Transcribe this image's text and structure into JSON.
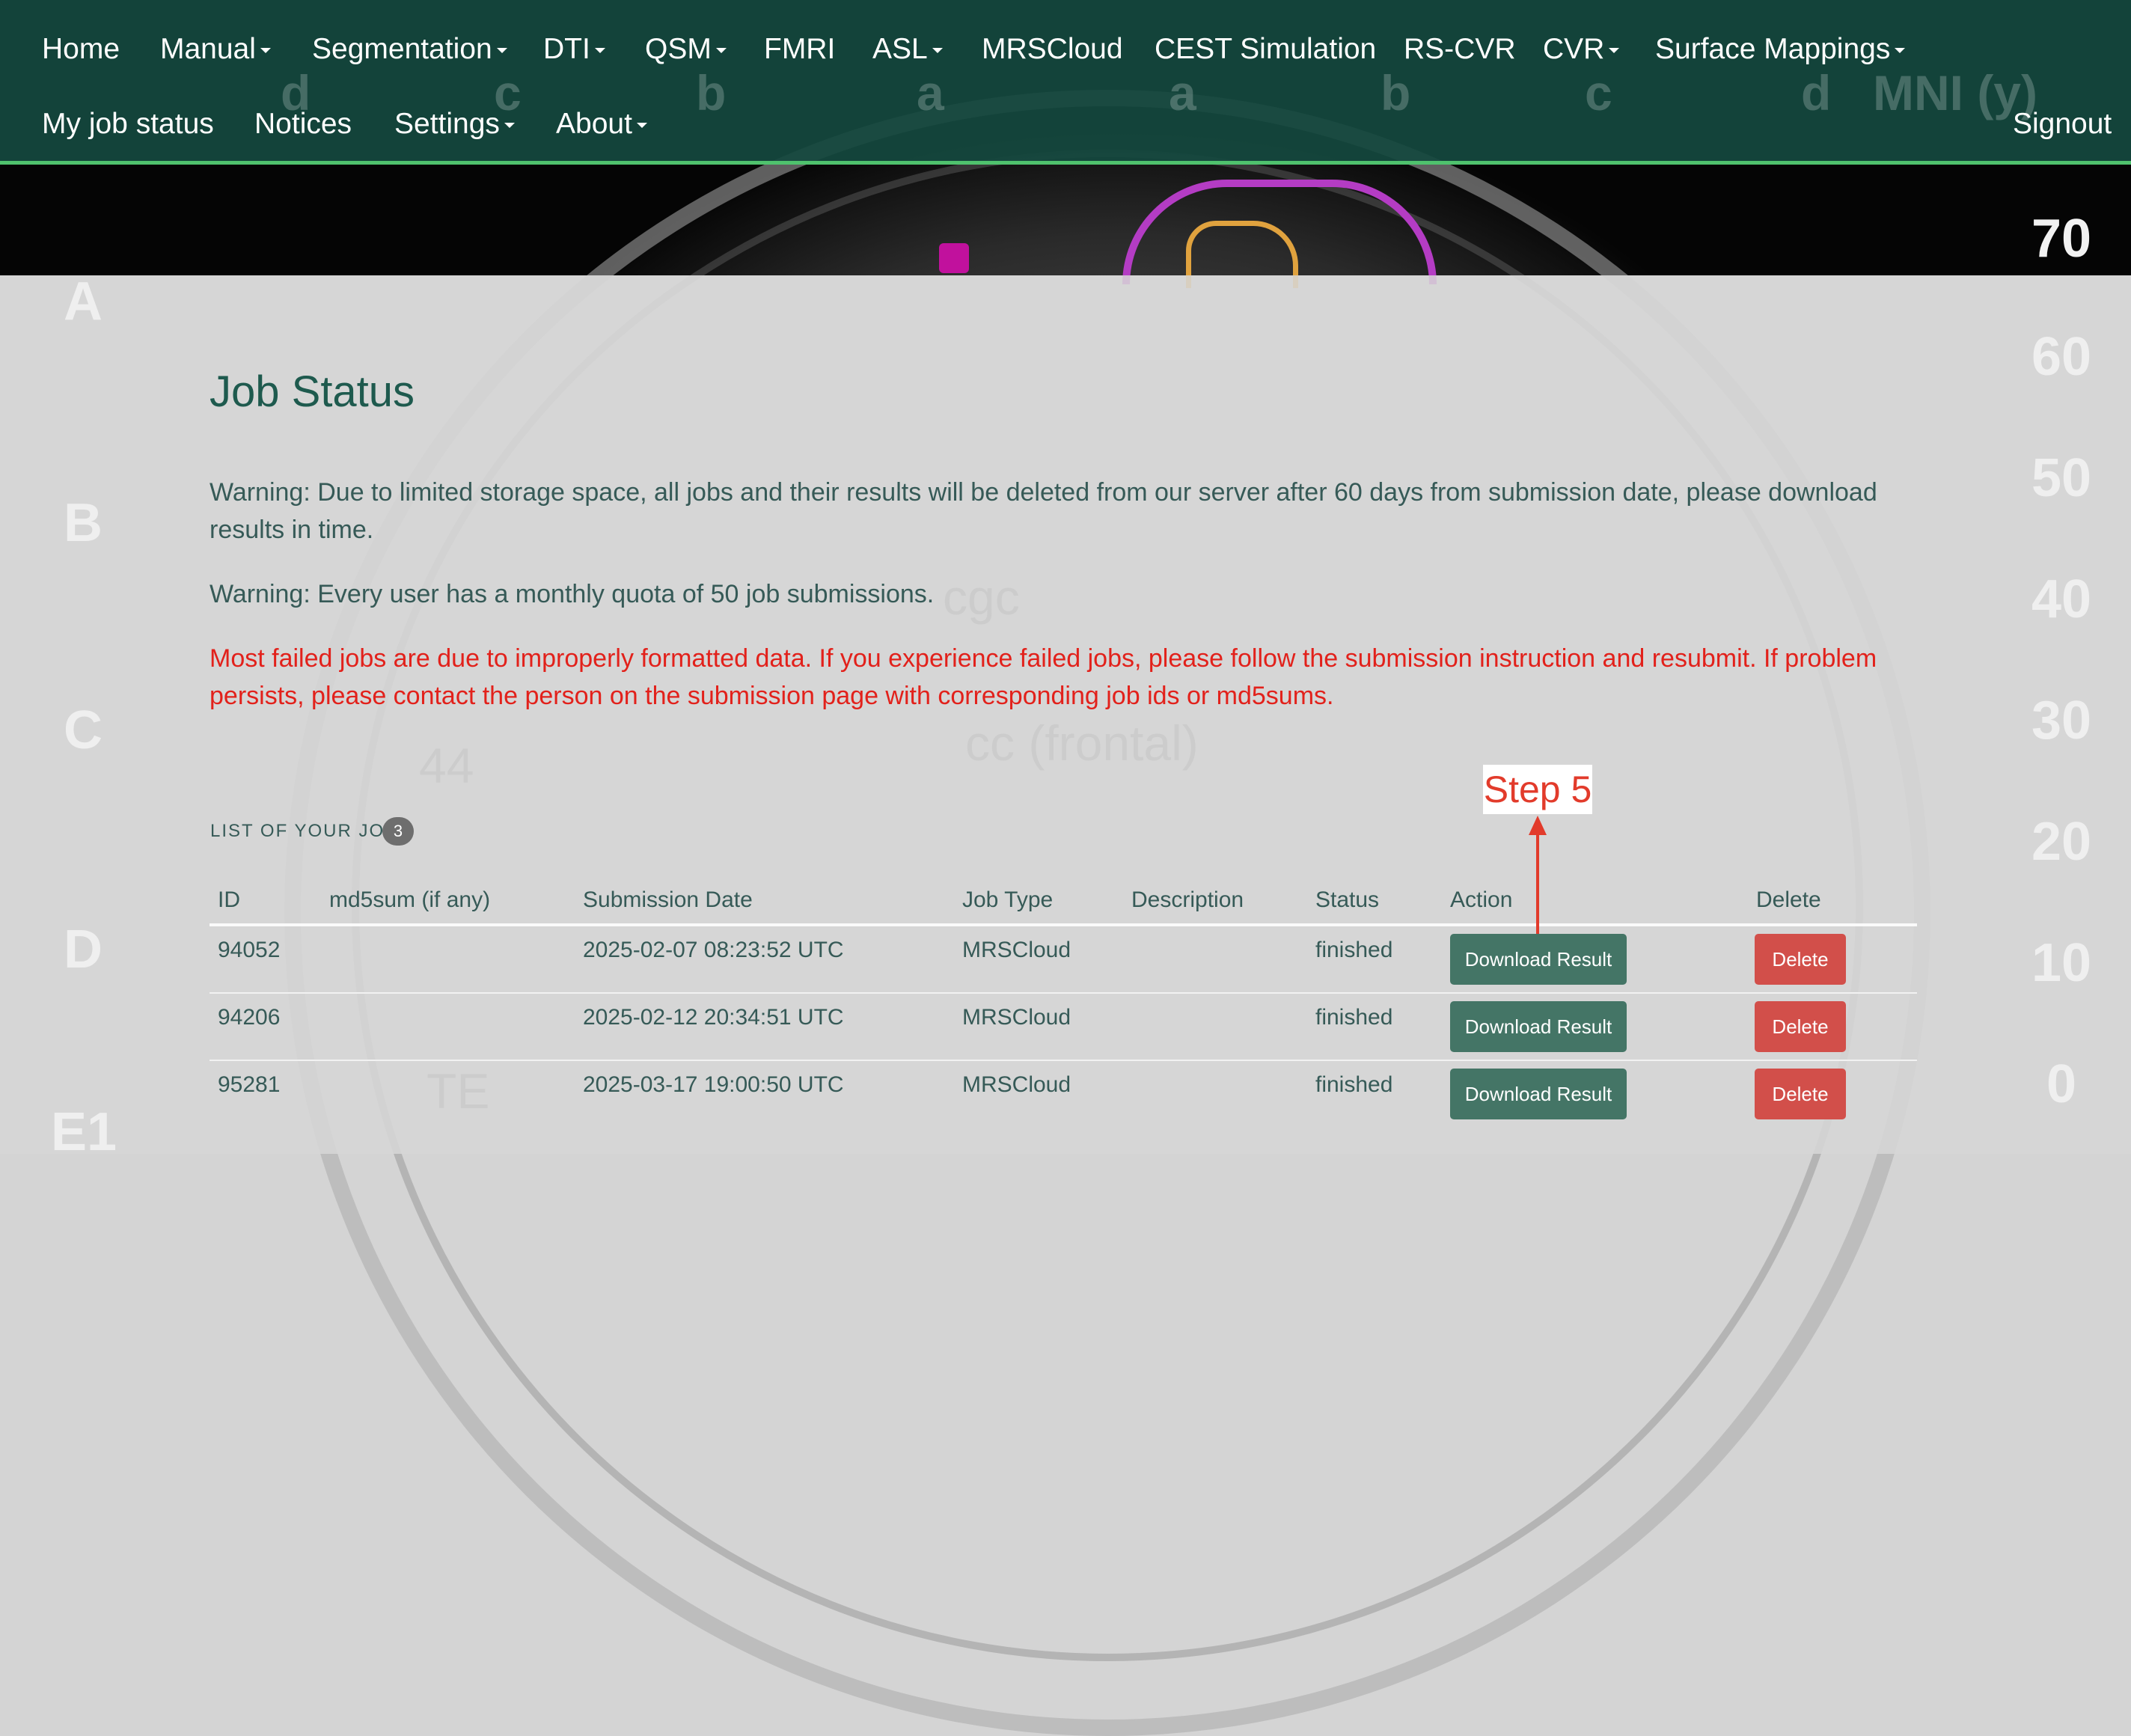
{
  "colors": {
    "navbar_bg": "#14483e",
    "navbar_border": "#4fc26d",
    "title": "#1e5a4e",
    "text": "#365a57",
    "warning_red": "#e2211b",
    "download_button": "#447566",
    "delete_button": "#d24f4a",
    "annotation": "#e23b2b"
  },
  "background": {
    "ruler_numbers": [
      "70",
      "60",
      "50",
      "40",
      "30",
      "20",
      "10",
      "0"
    ],
    "row_letters": [
      "A",
      "B",
      "C",
      "D",
      "E1"
    ],
    "column_letters": [
      "d",
      "c",
      "b",
      "a",
      "a",
      "b",
      "c",
      "d"
    ],
    "axis_label": "MNI (y)",
    "labels": [
      "cgc",
      "cc (frontal)",
      "44",
      "TE"
    ]
  },
  "navbar": {
    "row1": [
      {
        "label": "Home",
        "dropdown": false
      },
      {
        "label": "Manual",
        "dropdown": true
      },
      {
        "label": "Segmentation",
        "dropdown": true
      },
      {
        "label": "DTI",
        "dropdown": true
      },
      {
        "label": "QSM",
        "dropdown": true
      },
      {
        "label": "FMRI",
        "dropdown": false
      },
      {
        "label": "ASL",
        "dropdown": true
      },
      {
        "label": "MRSCloud",
        "dropdown": false
      },
      {
        "label": "CEST Simulation",
        "dropdown": false
      },
      {
        "label": "RS-CVR",
        "dropdown": false
      },
      {
        "label": "CVR",
        "dropdown": true
      },
      {
        "label": "Surface Mappings",
        "dropdown": true
      }
    ],
    "row2": [
      {
        "label": "My job status",
        "dropdown": false
      },
      {
        "label": "Notices",
        "dropdown": false
      },
      {
        "label": "Settings",
        "dropdown": true
      },
      {
        "label": "About",
        "dropdown": true
      }
    ],
    "signout": "Signout"
  },
  "page": {
    "title": "Job Status",
    "warning1": "Warning: Due to limited storage space, all jobs and their results will be deleted from our server after 60 days from submission date, please download results in time.",
    "warning2": "Warning: Every user has a monthly quota of 50 job submissions.",
    "failed_notice": "Most failed jobs are due to improperly formatted data. If you experience failed jobs, please follow the submission instruction and resubmit. If problem persists, please contact the person on the submission page with corresponding job ids or md5sums."
  },
  "jobs": {
    "heading": "LIST OF YOUR JOBS",
    "count": "3",
    "columns": [
      "ID",
      "md5sum (if any)",
      "Submission Date",
      "Job Type",
      "Description",
      "Status",
      "Action",
      "Delete"
    ],
    "rows": [
      {
        "id": "94052",
        "md5sum": "",
        "date": "2025-02-07 08:23:52 UTC",
        "type": "MRSCloud",
        "description": "",
        "status": "finished",
        "action": "Download Result",
        "delete": "Delete"
      },
      {
        "id": "94206",
        "md5sum": "",
        "date": "2025-02-12 20:34:51 UTC",
        "type": "MRSCloud",
        "description": "",
        "status": "finished",
        "action": "Download Result",
        "delete": "Delete"
      },
      {
        "id": "95281",
        "md5sum": "",
        "date": "2025-03-17 19:00:50 UTC",
        "type": "MRSCloud",
        "description": "",
        "status": "finished",
        "action": "Download Result",
        "delete": "Delete"
      }
    ]
  },
  "annotation": {
    "label": "Step 5",
    "icon": "arrow-up-icon"
  }
}
